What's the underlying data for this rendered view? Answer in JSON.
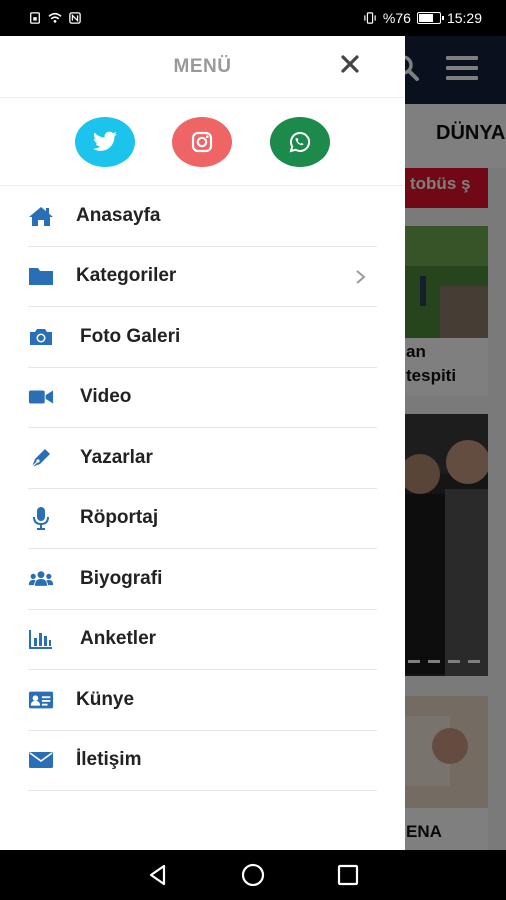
{
  "status_bar": {
    "battery_text": "%76",
    "time": "15:29",
    "battery_level": 0.76
  },
  "background": {
    "tab_label": "DÜNYA",
    "breaking_text": "tobüs ş",
    "card1_line1": "an",
    "card1_line2": "tespiti",
    "card3_text": "ENA"
  },
  "drawer": {
    "title": "MENÜ",
    "social": [
      {
        "name": "twitter",
        "icon": "twitter-icon",
        "color": "#1cc3ec"
      },
      {
        "name": "instagram",
        "icon": "instagram-icon",
        "color": "#ef6464"
      },
      {
        "name": "whatsapp",
        "icon": "whatsapp-icon",
        "color": "#1c8a4b"
      }
    ],
    "items": [
      {
        "label": "Anasayfa",
        "icon": "home-icon"
      },
      {
        "label": "Kategoriler",
        "icon": "folder-icon",
        "has_submenu": true
      },
      {
        "label": "Foto Galeri",
        "icon": "camera-icon"
      },
      {
        "label": "Video",
        "icon": "video-camera-icon"
      },
      {
        "label": "Yazarlar",
        "icon": "pen-icon"
      },
      {
        "label": "Röportaj",
        "icon": "microphone-icon"
      },
      {
        "label": "Biyografi",
        "icon": "users-icon"
      },
      {
        "label": "Anketler",
        "icon": "bar-chart-icon"
      },
      {
        "label": "Künye",
        "icon": "id-card-icon"
      },
      {
        "label": "İletişim",
        "icon": "envelope-icon"
      }
    ]
  },
  "colors": {
    "menu_icon": "#2a6fb5",
    "header_bg": "#13233d",
    "accent_red": "#e0122b"
  }
}
